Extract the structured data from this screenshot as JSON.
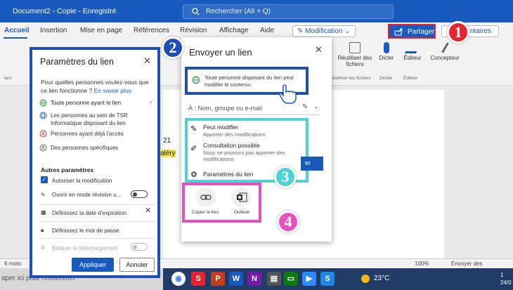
{
  "window": {
    "doc_title": "Document2 - Copie  -  Enregistré",
    "search_placeholder": "Rechercher (Alt + Q)"
  },
  "ribbon": {
    "tabs": [
      "Accueil",
      "Insertion",
      "Mise en page",
      "Références",
      "Révision",
      "Affichage",
      "Aide"
    ],
    "mode_label": "Modification",
    "share_label": "Partager",
    "comments_label": "ntaires",
    "groups": [
      {
        "label": "Réutiliser des fichiers",
        "sub": "Réutiliser les fichiers"
      },
      {
        "label": "Dicter",
        "sub": "Dictée"
      },
      {
        "label": "Éditeur",
        "sub": "Éditeur"
      },
      {
        "label": "Concepteur",
        "sub": ""
      }
    ],
    "clipboard_label": "iers"
  },
  "document": {
    "text_fragment_1": "21",
    "text_fragment_2": "aléry"
  },
  "status": {
    "words": "6 mots",
    "zoom": "100%",
    "feedback": "Envoyer des commentair"
  },
  "taskbar": {
    "search_text": "aper ici pour rechercher",
    "temperature": "23°C",
    "time_line1": "1",
    "time_line2": "24/0"
  },
  "link_settings": {
    "title": "Paramètres du lien",
    "question": "Pour quelles personnes voulez-vous que ce lien fonctionne ?",
    "learn_more": "En savoir plus",
    "options": [
      "Toute personne ayant le lien",
      "Les personnes au sein de TSR Informatique disposant du lien",
      "Personnes ayant déjà l'accès",
      "Des personnes spécifiques"
    ],
    "other_settings": "Autres paramètres",
    "allow_edit": "Autoriser la modification",
    "review_mode": "Ouvrir en mode révision u...",
    "expiry": "Définissez la date d'expiration",
    "password": "Définissez le mot de passe",
    "block_download": "Bloquer le téléchargement",
    "apply": "Appliquer",
    "cancel": "Annuler"
  },
  "send_link": {
    "title": "Envoyer un lien",
    "anyone_text": "Toute personne disposant du lien peut modifier le contenu",
    "to_placeholder": "À : Nom, groupe ou e-mail",
    "perm_edit_title": "Peut modifier",
    "perm_edit_sub": "Apporter des modifications",
    "perm_view_title": "Consultation possible",
    "perm_view_sub": "Nous ne pouvons pas apporter des modifications",
    "link_settings": "Paramètres du lien",
    "send_label": "er",
    "copy_link": "Copier le lien",
    "outlook": "Outlook"
  },
  "badges": [
    "1",
    "2",
    "3",
    "4"
  ],
  "colors": {
    "word_blue": "#185abd",
    "badge_red": "#e8232b",
    "badge_blue": "#1e4fb5",
    "badge_cyan": "#4fd2d6",
    "badge_pink": "#e84fc0"
  }
}
